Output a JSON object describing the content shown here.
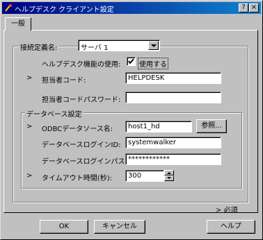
{
  "window": {
    "title": "ヘルプデスク クライアント設定",
    "minimize_glyph": "?",
    "close_glyph": "×"
  },
  "tab": {
    "label": "一般"
  },
  "connection": {
    "label": "接続定義名:",
    "selected": "サーバ 1"
  },
  "helpdesk_use": {
    "label": "ヘルプデスク機能の使用:",
    "checkbox_label": "使用する",
    "checked": true
  },
  "operator_code": {
    "marker": ">",
    "label": "担当者コード:",
    "value": "HELPDESK"
  },
  "operator_password": {
    "label": "担当者コードパスワード:",
    "value": ""
  },
  "db_group": {
    "label": "データベース設定",
    "odbc": {
      "marker": ">",
      "label": "ODBCデータソース名:",
      "value": "host1_hd",
      "browse_label": "参照..."
    },
    "login_id": {
      "label": "データベースログインID:",
      "value": "systemwalker"
    },
    "login_password": {
      "label": "データベースログインパスワード:",
      "value": "************"
    },
    "timeout": {
      "marker": ">",
      "label": "タイムアウト時間(秒):",
      "value": "300"
    }
  },
  "required_note": "> 必須",
  "buttons": {
    "ok": "OK",
    "cancel": "キャンセル",
    "help": "ヘルプ"
  }
}
